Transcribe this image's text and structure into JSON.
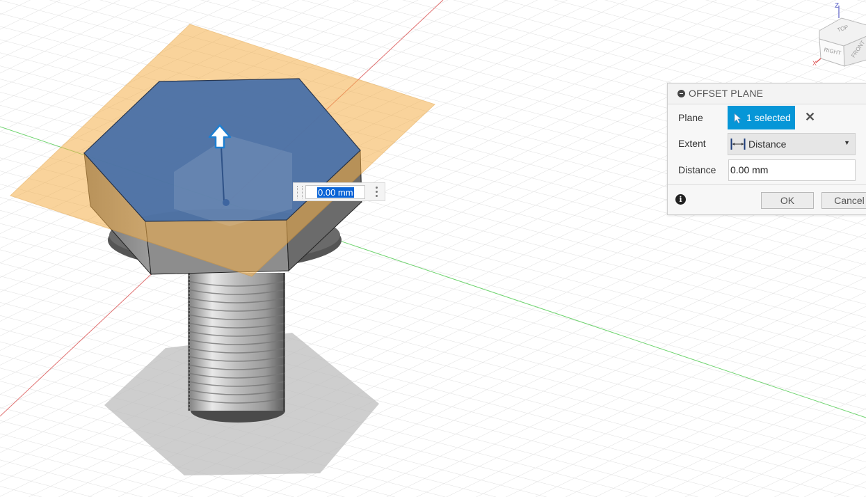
{
  "canvas": {
    "manipulator_value": "0.00 mm",
    "view_cube": {
      "top": "TOP",
      "right": "RIGHT",
      "front": "FRONT",
      "axis_z": "Z",
      "axis_x": "X"
    }
  },
  "dialog": {
    "title": "OFFSET PLANE",
    "plane_label": "Plane",
    "plane_selection": "1 selected",
    "extent_label": "Extent",
    "extent_value": "Distance",
    "distance_label": "Distance",
    "distance_value": "0.00 mm",
    "ok_label": "OK",
    "cancel_label": "Cancel"
  },
  "colors": {
    "selected_face": "#4a71a8",
    "offset_plane": "#f5b04a",
    "selection_button": "#0696d7",
    "x_axis": "#e07070",
    "y_axis": "#6fd46f"
  },
  "icons": [
    "collapse-icon",
    "cursor-icon",
    "close-icon",
    "distance-icon",
    "dropdown-caret-icon",
    "info-icon",
    "offset-arrow-icon",
    "kebab-menu-icon"
  ]
}
